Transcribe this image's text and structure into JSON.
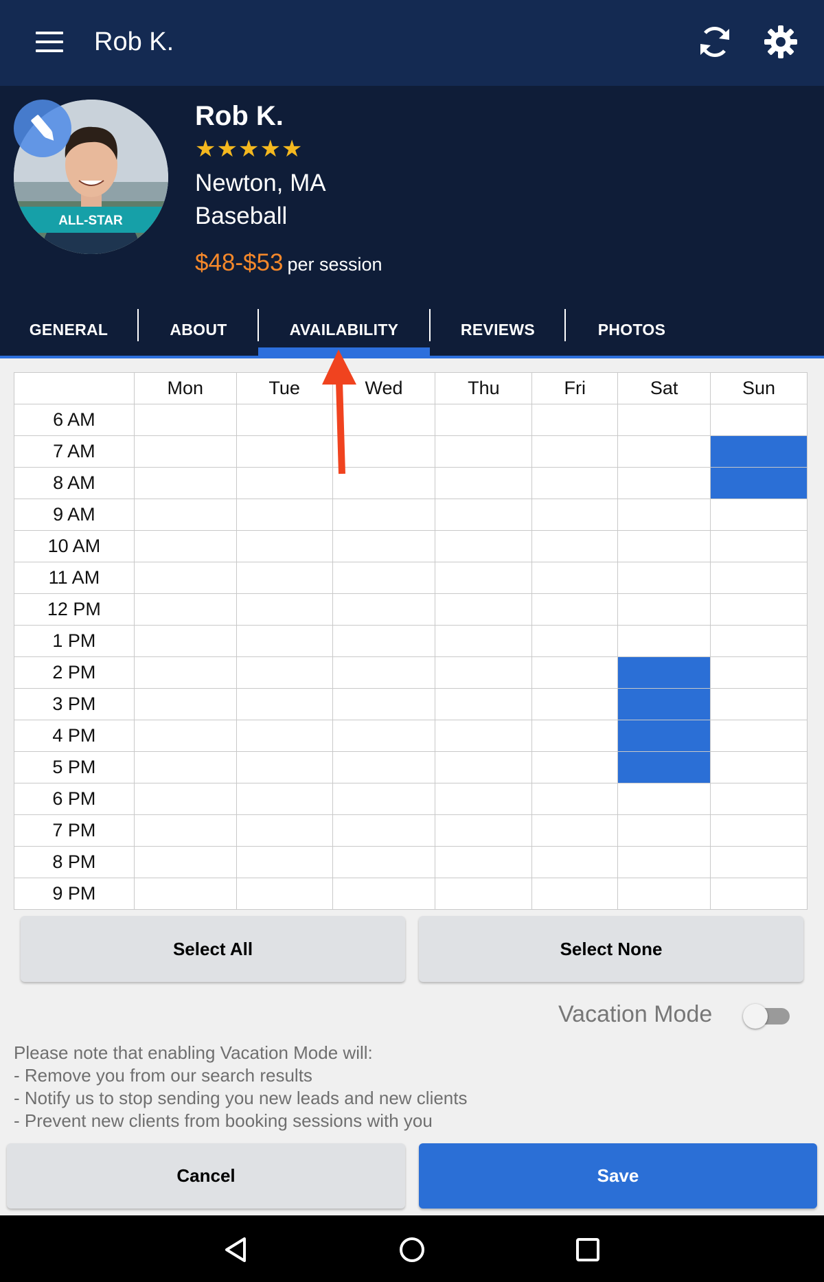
{
  "appbar": {
    "title": "Rob K.",
    "icons": [
      "menu-icon",
      "refresh-icon",
      "gear-icon"
    ]
  },
  "profile": {
    "name": "Rob K.",
    "rating": 5,
    "stars": "★★★★★",
    "location": "Newton, MA",
    "sport": "Baseball",
    "price": "$48-$53",
    "per_session": "per session",
    "badge": "ALL-STAR"
  },
  "tabs": [
    {
      "label": "GENERAL",
      "active": false
    },
    {
      "label": "ABOUT",
      "active": false
    },
    {
      "label": "AVAILABILITY",
      "active": true
    },
    {
      "label": "REVIEWS",
      "active": false
    },
    {
      "label": "PHOTOS",
      "active": false
    }
  ],
  "schedule": {
    "days": [
      "Mon",
      "Tue",
      "Wed",
      "Thu",
      "Fri",
      "Sat",
      "Sun"
    ],
    "times": [
      "6 AM",
      "7 AM",
      "8 AM",
      "9 AM",
      "10 AM",
      "11 AM",
      "12 PM",
      "1 PM",
      "2 PM",
      "3 PM",
      "4 PM",
      "5 PM",
      "6 PM",
      "7 PM",
      "8 PM",
      "9 PM"
    ],
    "selected": {
      "Sat": [
        "2 PM",
        "3 PM",
        "4 PM",
        "5 PM"
      ],
      "Sun": [
        "7 AM",
        "8 AM"
      ]
    }
  },
  "buttons": {
    "select_all": "Select All",
    "select_none": "Select None",
    "cancel": "Cancel",
    "save": "Save"
  },
  "vacation": {
    "label": "Vacation Mode",
    "enabled": false,
    "note_lines": [
      "Please note that enabling Vacation Mode will:",
      "- Remove you from our search results",
      "- Notify us to stop sending you new leads and new clients",
      "- Prevent new clients from booking sessions with you"
    ]
  },
  "colors": {
    "appbar": "#142a52",
    "header": "#0f1d38",
    "accent": "#2b6fd6",
    "price": "#f5882a",
    "star": "#f4b81f",
    "annotation": "#f0431f"
  }
}
